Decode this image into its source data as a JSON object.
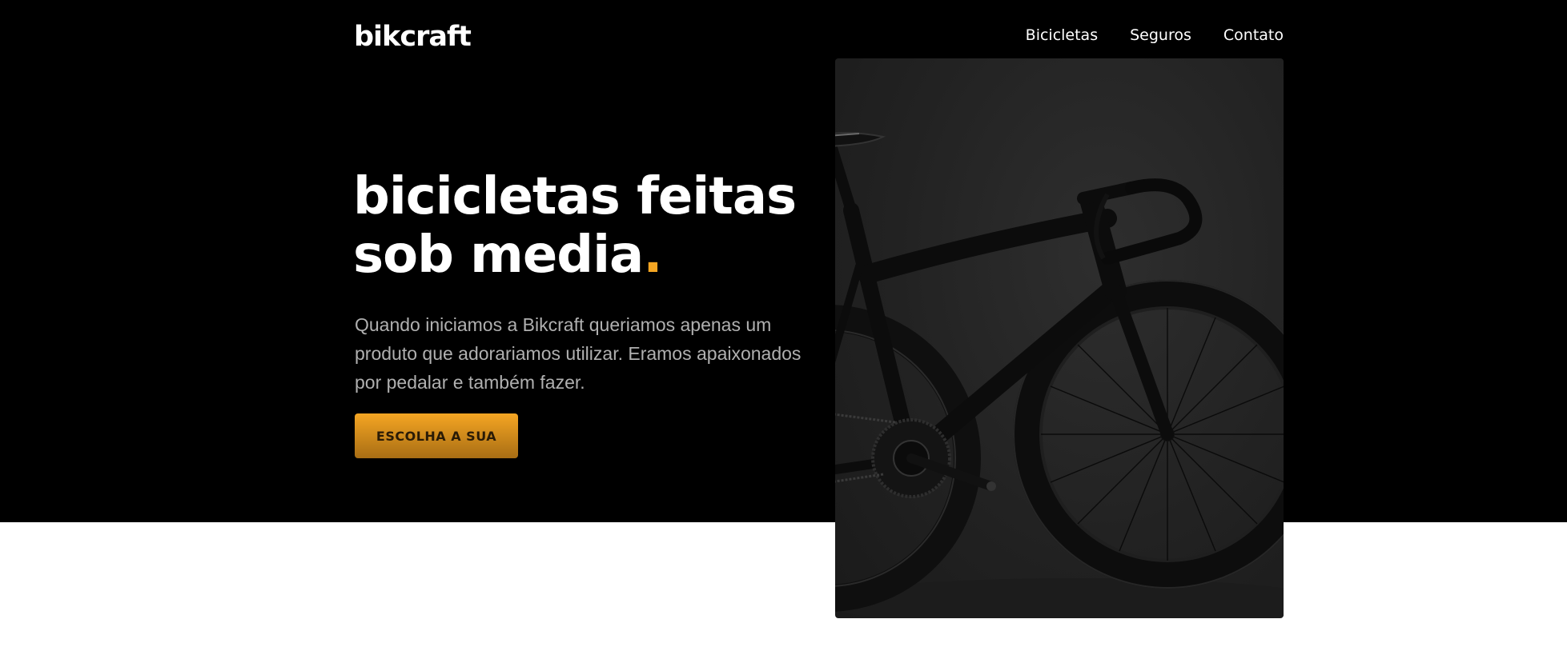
{
  "header": {
    "logo": "bikcraft",
    "nav": [
      {
        "label": "Bicicletas"
      },
      {
        "label": "Seguros"
      },
      {
        "label": "Contato"
      }
    ]
  },
  "hero": {
    "headline_line1": "bicicletas feitas",
    "headline_line2": "sob media",
    "headline_dot": ".",
    "description": "Quando iniciamos a Bikcraft queriamos apenas um produto que adorariamos utilizar. Eramos apaixonados por pedalar e também fazer.",
    "cta_label": "ESCOLHA A SUA",
    "image_icon": "bicycle-photo"
  },
  "colors": {
    "accent": "#f5a623",
    "hero_background": "#000000",
    "body_background": "#ffffff",
    "text_muted": "#b0b0b0"
  }
}
